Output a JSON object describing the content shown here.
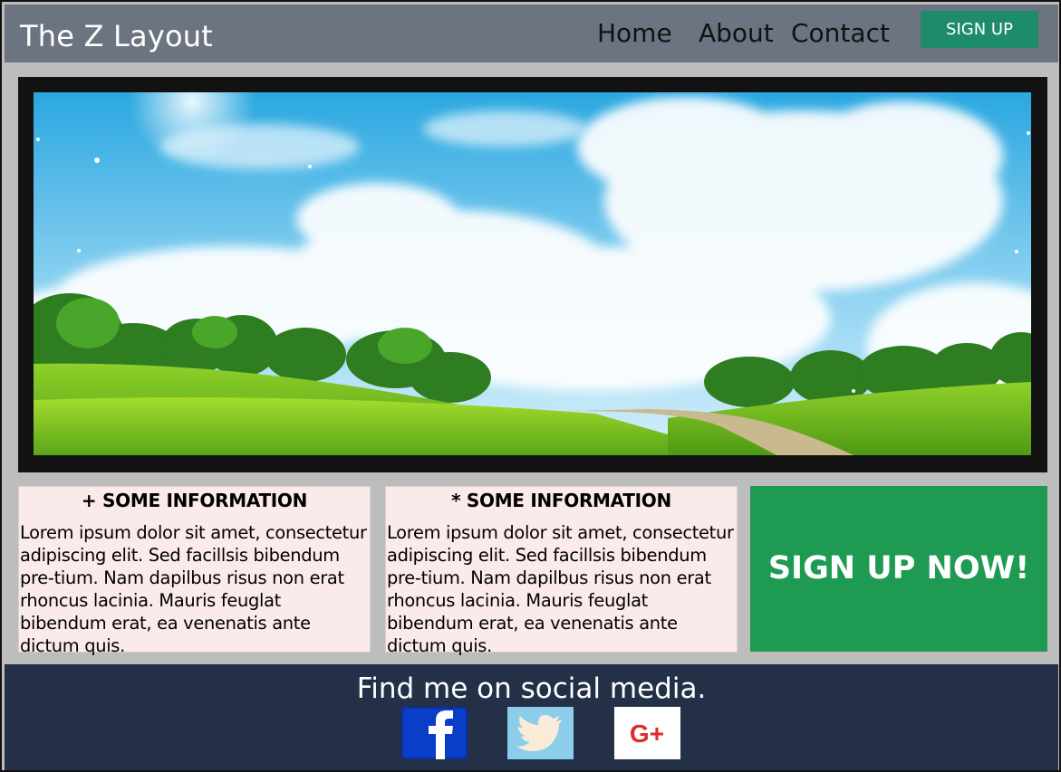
{
  "header": {
    "brand": "The Z Layout",
    "nav": [
      "Home",
      "About",
      "Contact"
    ],
    "signup_label": "SIGN UP"
  },
  "hero": {
    "image": "landscape-hills-sky"
  },
  "cards": [
    {
      "title": "+ SOME INFORMATION",
      "body": "Lorem ipsum dolor sit amet, consectetur adipiscing elit. Sed facillsis bibendum pre-tium. Nam dapilbus risus non erat rhoncus lacinia. Mauris feuglat bibendum erat, ea venenatis ante dictum quis."
    },
    {
      "title": "*  SOME INFORMATION",
      "body": "Lorem ipsum dolor sit amet, consectetur adipiscing elit. Sed facillsis bibendum pre-tium. Nam dapilbus risus non erat rhoncus lacinia. Mauris feuglat bibendum erat, ea venenatis ante dictum quis."
    }
  ],
  "cta": {
    "label": "SIGN UP NOW!"
  },
  "footer": {
    "tagline": "Find me on social media.",
    "icons": [
      "facebook-icon",
      "twitter-icon",
      "google-plus-icon"
    ],
    "gplus_text": "G+"
  },
  "colors": {
    "header_bg": "#6b7480",
    "signup_bg": "#1e8c6a",
    "cta_bg": "#1e9a52",
    "card_bg": "#fbeaea",
    "footer_bg": "#233048"
  }
}
